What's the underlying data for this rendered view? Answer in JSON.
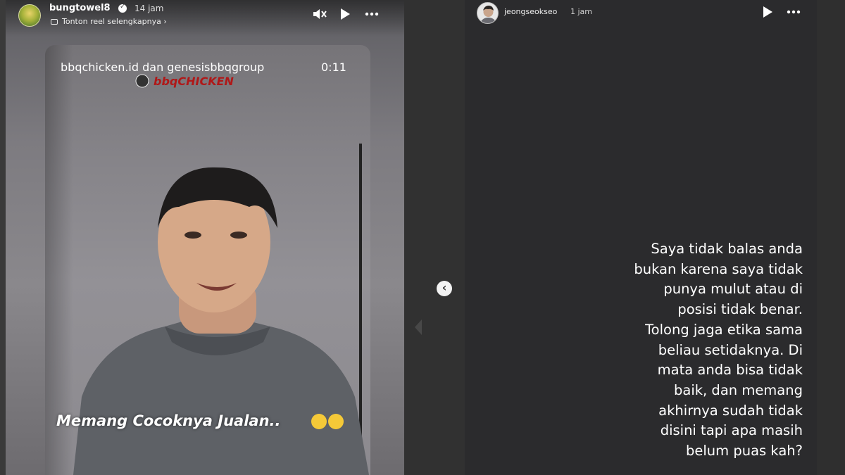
{
  "left_story": {
    "username": "bungtowel8",
    "time": "14 jam",
    "reel_link": "Tonton reel selengkapnya",
    "reel": {
      "credit": "bbqchicken.id dan genesisbbqgroup",
      "duration": "0:11",
      "brand_logo_text": "bbqCHICKEN",
      "caption": "Memang Cocoknya Jualan.."
    },
    "controls": [
      "mute-icon",
      "play-icon",
      "more-icon"
    ]
  },
  "right_story": {
    "username": "jeongseokseo",
    "time": "1 jam",
    "text_lines": [
      "Saya tidak balas anda",
      "bukan karena saya tidak",
      "punya mulut atau di",
      "posisi tidak benar.",
      "Tolong jaga etika sama",
      "beliau setidaknya. Di",
      "mata anda bisa tidak",
      "baik, dan memang",
      "akhirnya sudah tidak",
      "disini tapi apa masih",
      "belum puas kah?"
    ],
    "controls": [
      "play-icon",
      "more-icon"
    ]
  },
  "navigation": {
    "prev_icon": "chevron-left-icon"
  },
  "colors": {
    "background": "#2b2b2b",
    "text": "#ffffff",
    "emoji": "#f5c938"
  }
}
